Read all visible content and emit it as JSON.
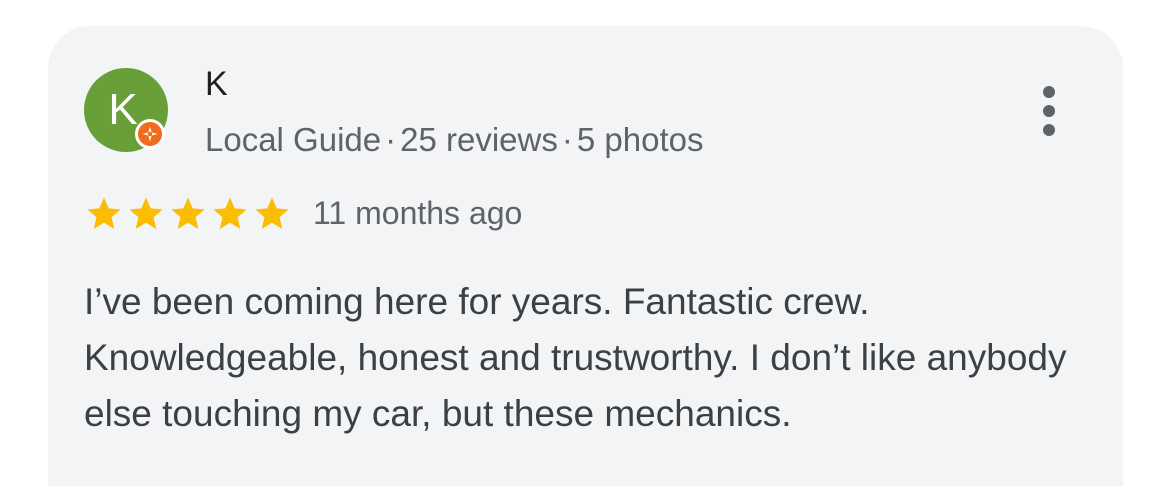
{
  "reviewer": {
    "avatar_initial": "K",
    "name": "K",
    "role": "Local Guide",
    "separator": "·",
    "review_count": "25 reviews",
    "photo_count": "5 photos"
  },
  "review": {
    "rating": 5,
    "rating_max": 5,
    "date": "11 months ago",
    "text": "I’ve been coming here for years. Fantastic crew. Knowledgeable, honest and trustworthy. I don’t like anybody else touching my car, but these mechanics."
  },
  "icons": {
    "star": "star-icon",
    "more": "more-vert-icon",
    "badge": "local-guide-badge-icon"
  },
  "colors": {
    "card_background": "#f3f4f6",
    "avatar_background": "#689f38",
    "badge": "#f26a1b",
    "star": "#fbbc04",
    "primary_text": "#1f1f1f",
    "secondary_text": "#5f6368",
    "body_text": "#3c4043"
  }
}
